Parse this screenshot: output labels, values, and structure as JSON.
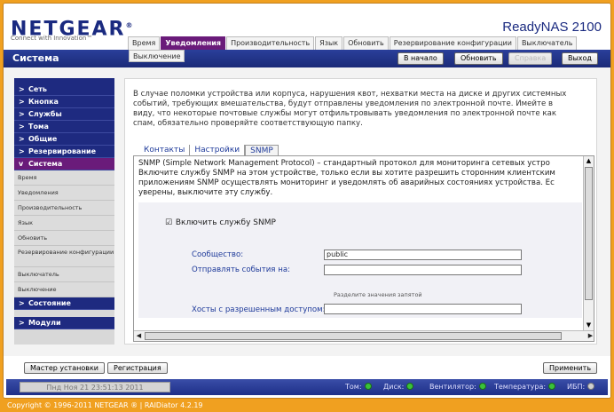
{
  "header": {
    "logo": "NETGEAR",
    "logo_mark": "®",
    "tagline": "Connect with Innovation™",
    "product": "ReadyNAS 2100"
  },
  "top_tabs": [
    "Время",
    "Уведомления",
    "Производительность",
    "Язык",
    "Обновить",
    "Резервирование конфигурации",
    "Выключатель"
  ],
  "active_tab": "Уведомления",
  "sub_tab": "Выключение",
  "bar": {
    "section_title": "Система",
    "home": "В начало",
    "refresh": "Обновить",
    "help": "Справка",
    "logout": "Выход"
  },
  "sidebar": {
    "items_top": [
      "Сеть",
      "Кнопка",
      "Службы",
      "Тома",
      "Общие",
      "Резервирование"
    ],
    "open_item": "Система",
    "sub_items": [
      "Время",
      "Уведомления",
      "Производительность",
      "Язык",
      "Обновить",
      "Резервирование конфигурации",
      "Выключатель",
      "Выключение"
    ],
    "status_item": "Состояние",
    "modules_item": "Модули"
  },
  "content": {
    "intro": "В случае поломки устройства или корпуса, нарушения квот, нехватки места на диске и других системных событий, требующих вмешательства, будут отправлены уведомления по электронной почте. Имейте в виду, что некоторые почтовые службы могут отфильтровывать уведомления по электронной почте как спам, обязательно проверяйте соответствующую папку.",
    "tabs": [
      "Контакты",
      "Настройки",
      "SNMP"
    ],
    "active_tab": "SNMP",
    "snmp_desc": "SNMP (Simple Network Management Protocol) – стандартный протокол для мониторинга сетевых устро\nВключите службу SNMP на этом устройстве, только если вы хотите разрешить сторонним клиентским\nприложениям SNMP осуществлять мониторинг и уведомлять об аварийных состояниях устройства. Ес\nуверены, выключите эту службу.",
    "enable_label": "Включить службу SNMP",
    "enable_checked": true,
    "community_label": "Сообщество:",
    "community_value": "public",
    "trap_label": "Отправлять события на:",
    "trap_value": "",
    "hint": "Разделите значения запятой",
    "hosts_label": "Хосты с разрешенным доступом:",
    "hosts_value": ""
  },
  "footer": {
    "wizard": "Мастер установки",
    "register": "Регистрация",
    "apply": "Применить",
    "datetime": "Пнд Ноя 21  23:51:13 2011",
    "status": [
      {
        "label": "Том:",
        "state": "ok"
      },
      {
        "label": "Диск:",
        "state": "ok"
      },
      {
        "label": "Вентилятор:",
        "state": "ok"
      },
      {
        "label": "Температура:",
        "state": "ok"
      },
      {
        "label": "ИБП:",
        "state": "off"
      }
    ],
    "copyright": "Copyright © 1996-2011 NETGEAR ® | RAIDiator 4.2.19"
  },
  "colors": {
    "background": "#f0a020",
    "nav_blue": "#1e2a80",
    "active_purple": "#6a1b7a",
    "status_ok": "#3ac23a"
  }
}
